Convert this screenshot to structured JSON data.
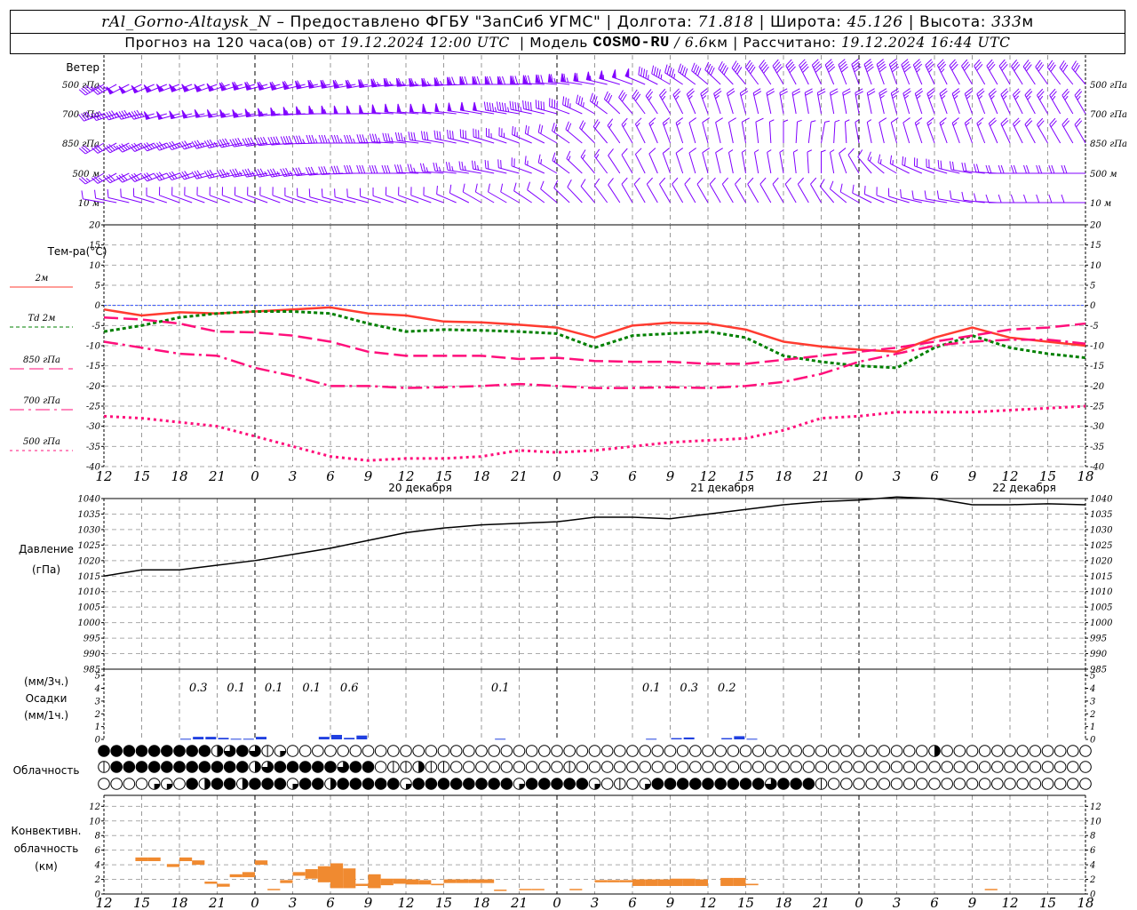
{
  "header": {
    "station": "rAl_Gorno-Altaysk_N",
    "provider": " – Предоставлено ФГБУ \"ЗапСиб УГМС\" | Долгота: ",
    "longitude": "71.818",
    "lat_label": " | Широта: ",
    "latitude": "45.126",
    "alt_label": " | Высота: ",
    "altitude": "333",
    "alt_unit": "м",
    "forecast_label": "Прогноз на 120 часа(ов) от ",
    "forecast_start": "19.12.2024 12:00 UTC",
    "model_label": "  | Модель ",
    "model": "COSMO-RU",
    "sep": " / ",
    "resolution": "6.6",
    "calc_label": "км | Рассчитано: ",
    "calc_time": "19.12.2024 16:44 UTC"
  },
  "labels": {
    "wind": "Ветер",
    "wind_levels": [
      "500 гПа",
      "700 гПа",
      "850 гПа",
      "500 м",
      "10 м"
    ],
    "temp_title": "Тем-ра(°C)",
    "temp_legend": [
      "2м",
      "Td  2м",
      "850 гПа",
      "700 гПа",
      "500 гПа"
    ],
    "pressure": [
      "Давление",
      "(гПа)"
    ],
    "precip": [
      "(мм/3ч.)",
      "Осадки",
      "(мм/1ч.)"
    ],
    "cloud": "Облачность",
    "conv": [
      "Конвективн.",
      "облачность",
      "(км)"
    ]
  },
  "colors": {
    "wind": "#8000ff",
    "t2m": "#ff3b30",
    "td2m": "#008000",
    "t850": "#ff0f7b",
    "t700": "#ff0f7b",
    "t500": "#ff0f7b",
    "zero_line": "#3050ff",
    "precip": "#2040e0",
    "conv": "#f08a30"
  },
  "chart_data": {
    "type": "line",
    "title": "Meteogram rAl_Gorno-Altaysk_N",
    "x_hours_from_start": [
      0,
      3,
      6,
      9,
      12,
      15,
      18,
      21,
      24,
      27,
      30,
      33,
      36,
      39,
      42,
      45,
      48,
      51,
      54,
      57,
      60,
      63,
      66,
      69,
      72,
      75,
      78
    ],
    "x_tick_labels": [
      "12",
      "15",
      "18",
      "21",
      "0",
      "3",
      "6",
      "9",
      "12",
      "15",
      "18",
      "21",
      "0",
      "3",
      "6",
      "9",
      "12",
      "15",
      "18",
      "21",
      "0",
      "3",
      "6",
      "9",
      "12",
      "15",
      "18"
    ],
    "date_labels": [
      {
        "hour": 36,
        "text": "20 декабря"
      },
      {
        "hour": 60,
        "text": "21 декабря"
      },
      {
        "hour": 84,
        "text": "22 декабря"
      }
    ],
    "wind": {
      "units": "kt",
      "levels": [
        {
          "name": "500 гПа",
          "dir": [
            240,
            245,
            250,
            250,
            255,
            255,
            260,
            260,
            265,
            265,
            270,
            270,
            275,
            280,
            290,
            300,
            310,
            320,
            330,
            335,
            340,
            340,
            335,
            330,
            330,
            325,
            320
          ],
          "speed": [
            45,
            50,
            55,
            55,
            60,
            60,
            60,
            60,
            65,
            65,
            70,
            70,
            70,
            60,
            50,
            45,
            40,
            40,
            40,
            40,
            40,
            40,
            35,
            30,
            30,
            30,
            30
          ]
        },
        {
          "name": "700 гПа",
          "dir": [
            250,
            255,
            255,
            260,
            260,
            265,
            270,
            270,
            275,
            275,
            280,
            280,
            285,
            300,
            320,
            330,
            340,
            345,
            350,
            350,
            350,
            345,
            340,
            340,
            335,
            330,
            330
          ],
          "speed": [
            40,
            45,
            50,
            50,
            55,
            55,
            55,
            50,
            50,
            50,
            50,
            45,
            40,
            35,
            30,
            25,
            25,
            20,
            20,
            20,
            20,
            25,
            25,
            25,
            25,
            25,
            25
          ]
        },
        {
          "name": "850 гПа",
          "dir": [
            240,
            245,
            250,
            255,
            260,
            265,
            270,
            270,
            275,
            280,
            285,
            290,
            300,
            315,
            330,
            340,
            345,
            350,
            0,
            10,
            350,
            345,
            340,
            340,
            335,
            330,
            330
          ],
          "speed": [
            30,
            35,
            35,
            35,
            40,
            40,
            35,
            35,
            35,
            30,
            30,
            25,
            20,
            20,
            15,
            15,
            10,
            10,
            5,
            5,
            5,
            10,
            15,
            15,
            20,
            20,
            20
          ]
        },
        {
          "name": "500 м",
          "dir": [
            240,
            245,
            250,
            255,
            260,
            260,
            265,
            270,
            270,
            275,
            280,
            285,
            300,
            320,
            330,
            340,
            345,
            350,
            350,
            0,
            330,
            300,
            290,
            280,
            270,
            270,
            270
          ],
          "speed": [
            25,
            30,
            30,
            30,
            35,
            35,
            30,
            30,
            30,
            25,
            25,
            20,
            15,
            15,
            10,
            10,
            10,
            5,
            5,
            5,
            10,
            15,
            20,
            20,
            20,
            20,
            20
          ]
        },
        {
          "name": "10 м",
          "dir": [
            280,
            285,
            290,
            290,
            290,
            290,
            285,
            285,
            290,
            290,
            300,
            300,
            310,
            320,
            330,
            330,
            330,
            330,
            330,
            330,
            300,
            290,
            280,
            280,
            270,
            270,
            270
          ],
          "speed": [
            10,
            12,
            12,
            12,
            12,
            12,
            12,
            12,
            12,
            10,
            10,
            10,
            10,
            10,
            10,
            8,
            8,
            8,
            8,
            8,
            8,
            8,
            10,
            10,
            10,
            10,
            10
          ]
        }
      ]
    },
    "temperature": {
      "ylim": [
        -40,
        20
      ],
      "yticks": [
        20,
        15,
        10,
        5,
        0,
        -5,
        -10,
        -15,
        -20,
        -25,
        -30,
        -35,
        -40
      ],
      "series": [
        {
          "name": "2м",
          "key": "t2m",
          "values": [
            -1,
            -2.5,
            -1.7,
            -2,
            -1.5,
            -1,
            -0.5,
            -2,
            -2.5,
            -4,
            -4.2,
            -4.8,
            -5.5,
            -8,
            -5,
            -4.3,
            -4.5,
            -6,
            -9,
            -10.2,
            -11,
            -11.5,
            -8,
            -5.5,
            -8,
            -9,
            -10
          ]
        },
        {
          "name": "Td 2м",
          "key": "td2m",
          "values": [
            -6.5,
            -5,
            -3,
            -2,
            -1.5,
            -1.5,
            -2,
            -4.5,
            -6.5,
            -6,
            -6.2,
            -6.5,
            -7,
            -10.5,
            -7.5,
            -7,
            -6.5,
            -8,
            -12.5,
            -14,
            -15,
            -15.5,
            -10.5,
            -7.5,
            -10.5,
            -12,
            -13
          ]
        },
        {
          "name": "850 гПа",
          "key": "t850",
          "values": [
            -3,
            -3.5,
            -4.5,
            -6.5,
            -6.7,
            -7.5,
            -9,
            -11.5,
            -12.5,
            -12.5,
            -12.5,
            -13.3,
            -13,
            -13.8,
            -14,
            -14,
            -14.5,
            -14.5,
            -13.5,
            -12.5,
            -11.5,
            -10.5,
            -9,
            -7.5,
            -6,
            -5.5,
            -4.5
          ]
        },
        {
          "name": "700 гПа",
          "key": "t700",
          "values": [
            -9,
            -10.5,
            -12,
            -12.5,
            -15.5,
            -17.5,
            -20,
            -20,
            -20.5,
            -20.3,
            -20,
            -19.5,
            -20,
            -20.5,
            -20.5,
            -20.3,
            -20.5,
            -20,
            -19,
            -17,
            -14,
            -12,
            -10,
            -9,
            -8.5,
            -8.5,
            -9.5
          ]
        },
        {
          "name": "500 гПа",
          "key": "t500",
          "values": [
            -27.5,
            -28,
            -29,
            -30,
            -32.5,
            -35,
            -37.5,
            -38.5,
            -38,
            -38,
            -37.5,
            -36,
            -36.5,
            -36,
            -35,
            -34,
            -33.5,
            -33,
            -31,
            -28,
            -27.5,
            -26.5,
            -26.5,
            -26.5,
            -26,
            -25.5,
            -25
          ]
        }
      ]
    },
    "pressure": {
      "ylim": [
        985,
        1040
      ],
      "yticks": [
        1040,
        1035,
        1030,
        1025,
        1020,
        1015,
        1010,
        1005,
        1000,
        995,
        990,
        985
      ],
      "values": [
        1015,
        1017,
        1017,
        1018.5,
        1020,
        1022,
        1024,
        1026.5,
        1029,
        1030.5,
        1031.5,
        1032,
        1032.5,
        1034,
        1034,
        1033.5,
        1035,
        1036.5,
        1038,
        1039,
        1039.5,
        1040.5,
        1040,
        1038,
        1038,
        1038.3,
        1038
      ]
    },
    "precip": {
      "ylim": [
        0,
        5.5
      ],
      "yticks": [
        5,
        4,
        3,
        2,
        1,
        0
      ],
      "hourly": [
        [
          6,
          0.05
        ],
        [
          7,
          0.2
        ],
        [
          8,
          0.2
        ],
        [
          9,
          0.12
        ],
        [
          10,
          0.05
        ],
        [
          11,
          0.05
        ],
        [
          12,
          0.2
        ],
        [
          17,
          0.2
        ],
        [
          18,
          0.35
        ],
        [
          19,
          0.12
        ],
        [
          20,
          0.3
        ],
        [
          31,
          0.05
        ],
        [
          43,
          0.05
        ],
        [
          45,
          0.1
        ],
        [
          46,
          0.15
        ],
        [
          49,
          0.1
        ],
        [
          50,
          0.25
        ],
        [
          51,
          0.05
        ]
      ],
      "three_hour_totals": [
        [
          6,
          "0.3"
        ],
        [
          9,
          "0.1"
        ],
        [
          12,
          "0.1"
        ],
        [
          15,
          "0.1"
        ],
        [
          18,
          "0.6"
        ],
        [
          30,
          "0.1"
        ],
        [
          42,
          "0.1"
        ],
        [
          45,
          "0.3"
        ],
        [
          48,
          "0.2"
        ]
      ]
    },
    "cloudiness_rows": [
      "4444444442343150000000000000000000000000000000000000000000000000002000000000000",
      "1444444444442344444344011211000000000100000000000000000000000000000000000000000",
      "0000550424424445442444445444444445444445010544444444434441000000000000000000000"
    ],
    "convective": {
      "ylim": [
        0,
        13.5
      ],
      "yticks": [
        12,
        10,
        8,
        6,
        4,
        2,
        0
      ],
      "cells": [
        [
          3,
          4.5,
          5
        ],
        [
          4,
          4.5,
          5
        ],
        [
          5.5,
          3.7,
          4.1
        ],
        [
          6.5,
          4.5,
          5
        ],
        [
          7.5,
          4,
          4.6
        ],
        [
          8.5,
          1.4,
          1.7
        ],
        [
          9.5,
          1,
          1.4
        ],
        [
          10.5,
          2.3,
          2.7
        ],
        [
          11.5,
          2.3,
          3
        ],
        [
          12.5,
          4,
          4.6
        ],
        [
          13.5,
          0.6,
          0.7
        ],
        [
          14.5,
          1.5,
          1.9
        ],
        [
          15.5,
          2.5,
          3
        ],
        [
          16.5,
          2.1,
          3.4
        ],
        [
          17.5,
          1.6,
          3.8
        ],
        [
          18.5,
          0.8,
          4.2
        ],
        [
          19.5,
          0.8,
          3.5
        ],
        [
          20.5,
          1.1,
          1.4
        ],
        [
          21.5,
          0.8,
          2.7
        ],
        [
          22.5,
          1.2,
          2.1
        ],
        [
          23.5,
          1.4,
          2.1
        ],
        [
          24.5,
          1.3,
          2.0
        ],
        [
          25.5,
          1.3,
          1.9
        ],
        [
          26.5,
          1.2,
          1.4
        ],
        [
          27.5,
          1.5,
          2.0
        ],
        [
          28.5,
          1.5,
          2.0
        ],
        [
          29.5,
          1.5,
          2.0
        ],
        [
          30.5,
          1.5,
          2.0
        ],
        [
          31.5,
          0.5,
          0.6
        ],
        [
          33.5,
          0.6,
          0.7
        ],
        [
          34.5,
          0.6,
          0.7
        ],
        [
          37.5,
          0.6,
          0.7
        ],
        [
          39.5,
          1.6,
          1.9
        ],
        [
          40.5,
          1.6,
          1.9
        ],
        [
          41.5,
          1.6,
          1.9
        ],
        [
          42.5,
          1.1,
          2.0
        ],
        [
          43.5,
          1.1,
          2.0
        ],
        [
          44.5,
          1.1,
          2.0
        ],
        [
          45.5,
          1.1,
          2.1
        ],
        [
          46.5,
          1.1,
          2.1
        ],
        [
          47.5,
          1.1,
          2.0
        ],
        [
          49.5,
          1.1,
          2.2
        ],
        [
          50.5,
          1.1,
          2.2
        ],
        [
          51.5,
          1.2,
          1.4
        ],
        [
          70.5,
          0.6,
          0.7
        ]
      ]
    }
  }
}
